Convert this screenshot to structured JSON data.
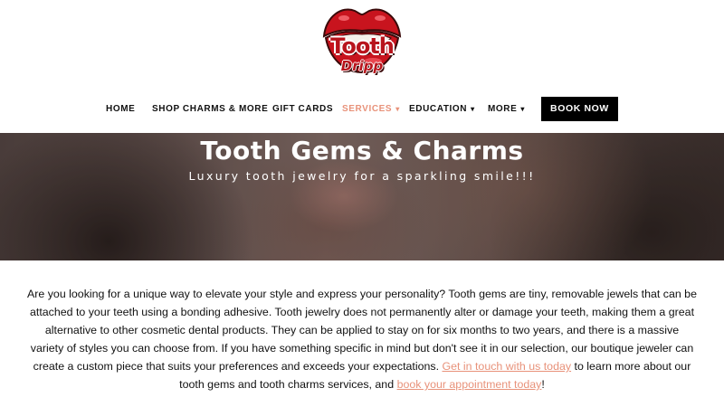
{
  "logo": {
    "line1": "Tooth",
    "line2": "Dripp",
    "lip_color": "#c8141e"
  },
  "nav": {
    "items": [
      {
        "label": "HOME",
        "caret": ""
      },
      {
        "label": "SHOP CHARMS & MORE",
        "caret": ""
      },
      {
        "label": "GIFT CARDS",
        "caret": ""
      },
      {
        "label": "SERVICES",
        "caret": "▾",
        "active": true
      },
      {
        "label": "EDUCATION",
        "caret": "▾"
      },
      {
        "label": "MORE",
        "caret": "▾"
      }
    ],
    "cta": "BOOK NOW",
    "active_color": "#e8927a"
  },
  "hero": {
    "title": "Tooth Gems & Charms",
    "subtitle": "Luxury tooth jewelry for a sparkling smile!!!"
  },
  "content": {
    "text_before": "Are you looking for a unique way to elevate your style and express your personality? Tooth gems are tiny, removable jewels that can be attached to your teeth using a bonding adhesive. Tooth jewelry does not permanently alter or damage your teeth, making them a great alternative to other cosmetic dental products. They can be applied to stay on for six months to two years, and there is a massive variety of styles you can choose from. If you have something specific in mind but don't see it in our selection, our boutique jeweler can create a custom piece that suits your preferences and exceeds your expectations.",
    "link1": "Get in touch with us today",
    "text_middle": "to learn more about our tooth gems and tooth charms services, and",
    "link2": "book your appointment today",
    "text_end": "!",
    "link_color": "#e8927a"
  }
}
